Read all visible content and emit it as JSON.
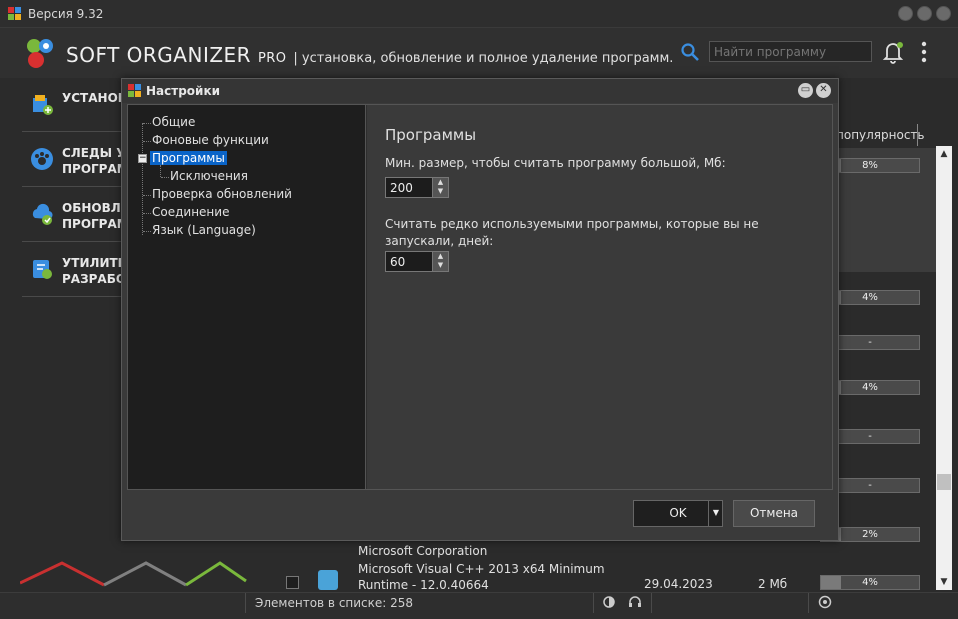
{
  "window": {
    "version": "Версия 9.32"
  },
  "header": {
    "brand": "SOFT ORGANIZER",
    "edition": "PRO",
    "tagline": "| установка, обновление и полное удаление программ.",
    "search_placeholder": "Найти программу"
  },
  "sidebar": {
    "items": [
      {
        "label": "УСТАНОВИ"
      },
      {
        "label": "СЛЕДЫ УЖ\nПРОГРАМ"
      },
      {
        "label": "ОБНОВЛЕ\nПРОГРАМ"
      },
      {
        "label": "УТИЛИТЫ\nРАЗРАБОТ"
      }
    ]
  },
  "list": {
    "column_popularity": "популярность",
    "popularity_values": [
      "8%",
      "4%",
      "-",
      "4%",
      "-",
      "-",
      "2%",
      "4%"
    ],
    "popularity_fractions": [
      0.08,
      0.04,
      0,
      0.04,
      0,
      0,
      0.02,
      0.04
    ],
    "bottom_row": {
      "publisher": "Microsoft Corporation",
      "name": "Microsoft Visual C++ 2013 x64 Minimum Runtime - 12.0.40664",
      "date": "29.04.2023",
      "size": "2 Мб"
    }
  },
  "status": {
    "count_text": "Элементов в списке: 258"
  },
  "dialog": {
    "title": "Настройки",
    "tree": [
      "Общие",
      "Фоновые функции",
      "Программы",
      "Исключения",
      "Проверка обновлений",
      "Соединение",
      "Язык (Language)"
    ],
    "tree_expander": "−",
    "panel_title": "Программы",
    "min_size_label": "Мин. размер, чтобы считать программу большой, Мб:",
    "min_size_value": "200",
    "rare_label": "Считать редко используемыми программы, которые вы не запускали, дней:",
    "rare_value": "60",
    "ok_label": "OK",
    "cancel_label": "Отмена"
  },
  "colors": {
    "selection": "#0a64c8",
    "accent_green": "#7ab83c",
    "accent_red": "#d03030"
  }
}
